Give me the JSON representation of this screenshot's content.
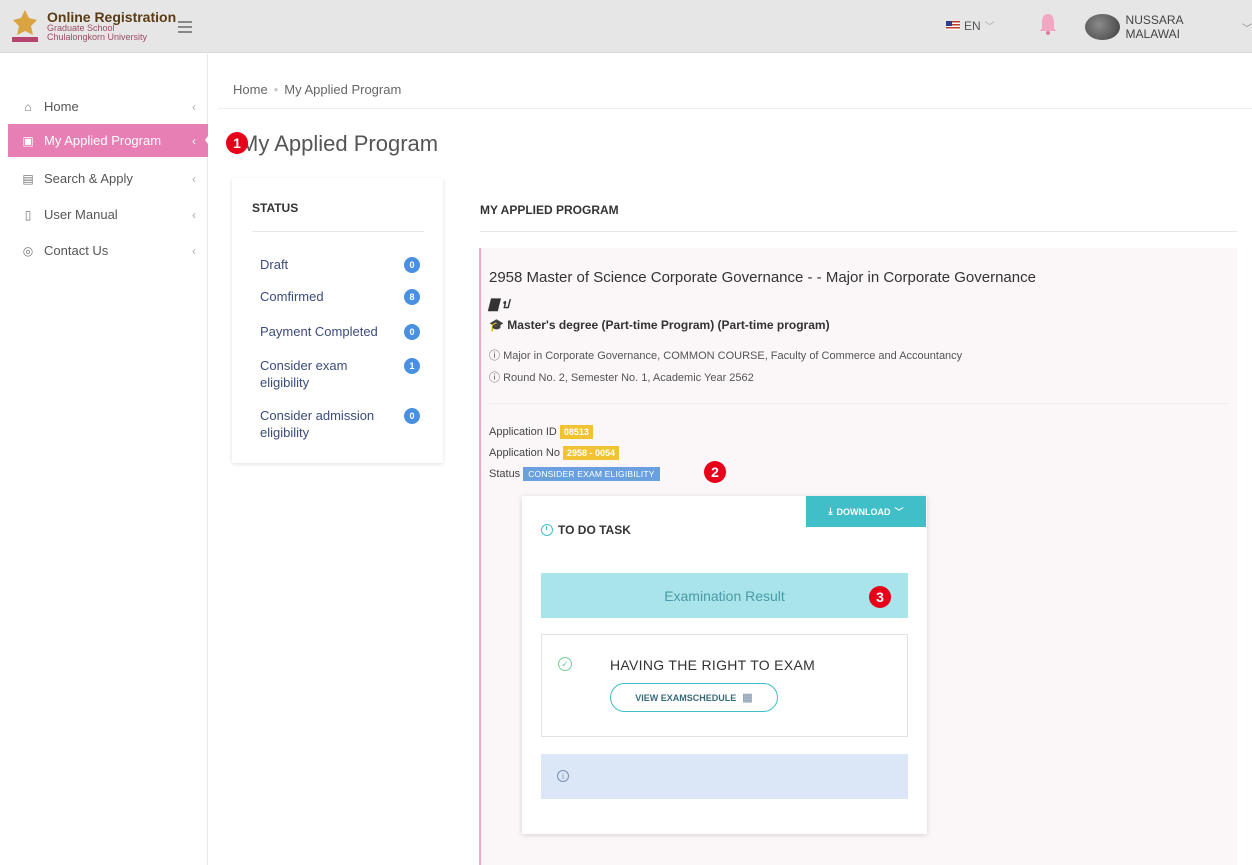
{
  "header": {
    "logo_title": "Online Registration",
    "logo_sub1": "Graduate School",
    "logo_sub2": "Chulalongkorn University",
    "language": "EN",
    "user_name": "NUSSARA MALAWAI"
  },
  "sidebar": {
    "items": [
      {
        "label": "Home",
        "icon": "home-icon"
      },
      {
        "label": "My Applied Program",
        "icon": "folder-icon"
      },
      {
        "label": "Search & Apply",
        "icon": "book-icon"
      },
      {
        "label": "User Manual",
        "icon": "manual-icon"
      },
      {
        "label": "Contact Us",
        "icon": "location-icon"
      }
    ]
  },
  "breadcrumb": {
    "home": "Home",
    "current": "My Applied Program"
  },
  "page_title": "My Applied Program",
  "status": {
    "title": "STATUS",
    "rows": [
      {
        "label": "Draft",
        "count": "0"
      },
      {
        "label": "Comfirmed",
        "count": "8"
      },
      {
        "label": "Payment Completed",
        "count": "0"
      },
      {
        "label": "Consider exam eligibility",
        "count": "1"
      },
      {
        "label": "Consider admission eligibility",
        "count": "0"
      }
    ]
  },
  "applied": {
    "section_title": "MY APPLIED PROGRAM",
    "program_title": "2958 Master of Science Corporate Governance - - Major in Corporate Governance",
    "program_line2": "ป",
    "degree": "Master's degree (Part-time Program) (Part-time program)",
    "info1": "Major in Corporate Governance, COMMON COURSE, Faculty of Commerce and Accountancy",
    "info2": "Round No. 2, Semester No. 1, Academic Year 2562",
    "application_id_label": "Application ID",
    "application_id": "08513",
    "application_no_label": "Application No",
    "application_no": "2958 - 0054",
    "status_label": "Status",
    "status_value": "CONSIDER EXAM ELIGIBILITY"
  },
  "todo": {
    "download_label": "DOWNLOAD",
    "title": "TO DO TASK",
    "exam_result": "Examination Result",
    "right_title": "HAVING THE RIGHT TO EXAM",
    "view_button": "VIEW EXAMSCHEDULE"
  },
  "annotations": [
    "1",
    "2",
    "3"
  ]
}
